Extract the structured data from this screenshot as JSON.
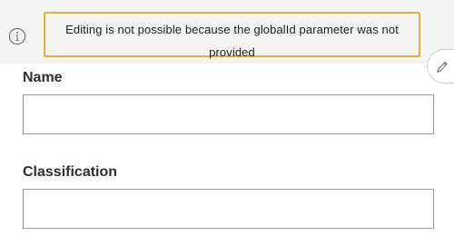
{
  "notice": {
    "message": "Editing is not possible because the globalId parameter was not provided",
    "icon": "info-icon",
    "border_color": "#e3b332"
  },
  "edit_tab": {
    "icon": "pencil-icon"
  },
  "fields": {
    "name": {
      "label": "Name",
      "value": ""
    },
    "classification": {
      "label": "Classification",
      "value": ""
    }
  }
}
